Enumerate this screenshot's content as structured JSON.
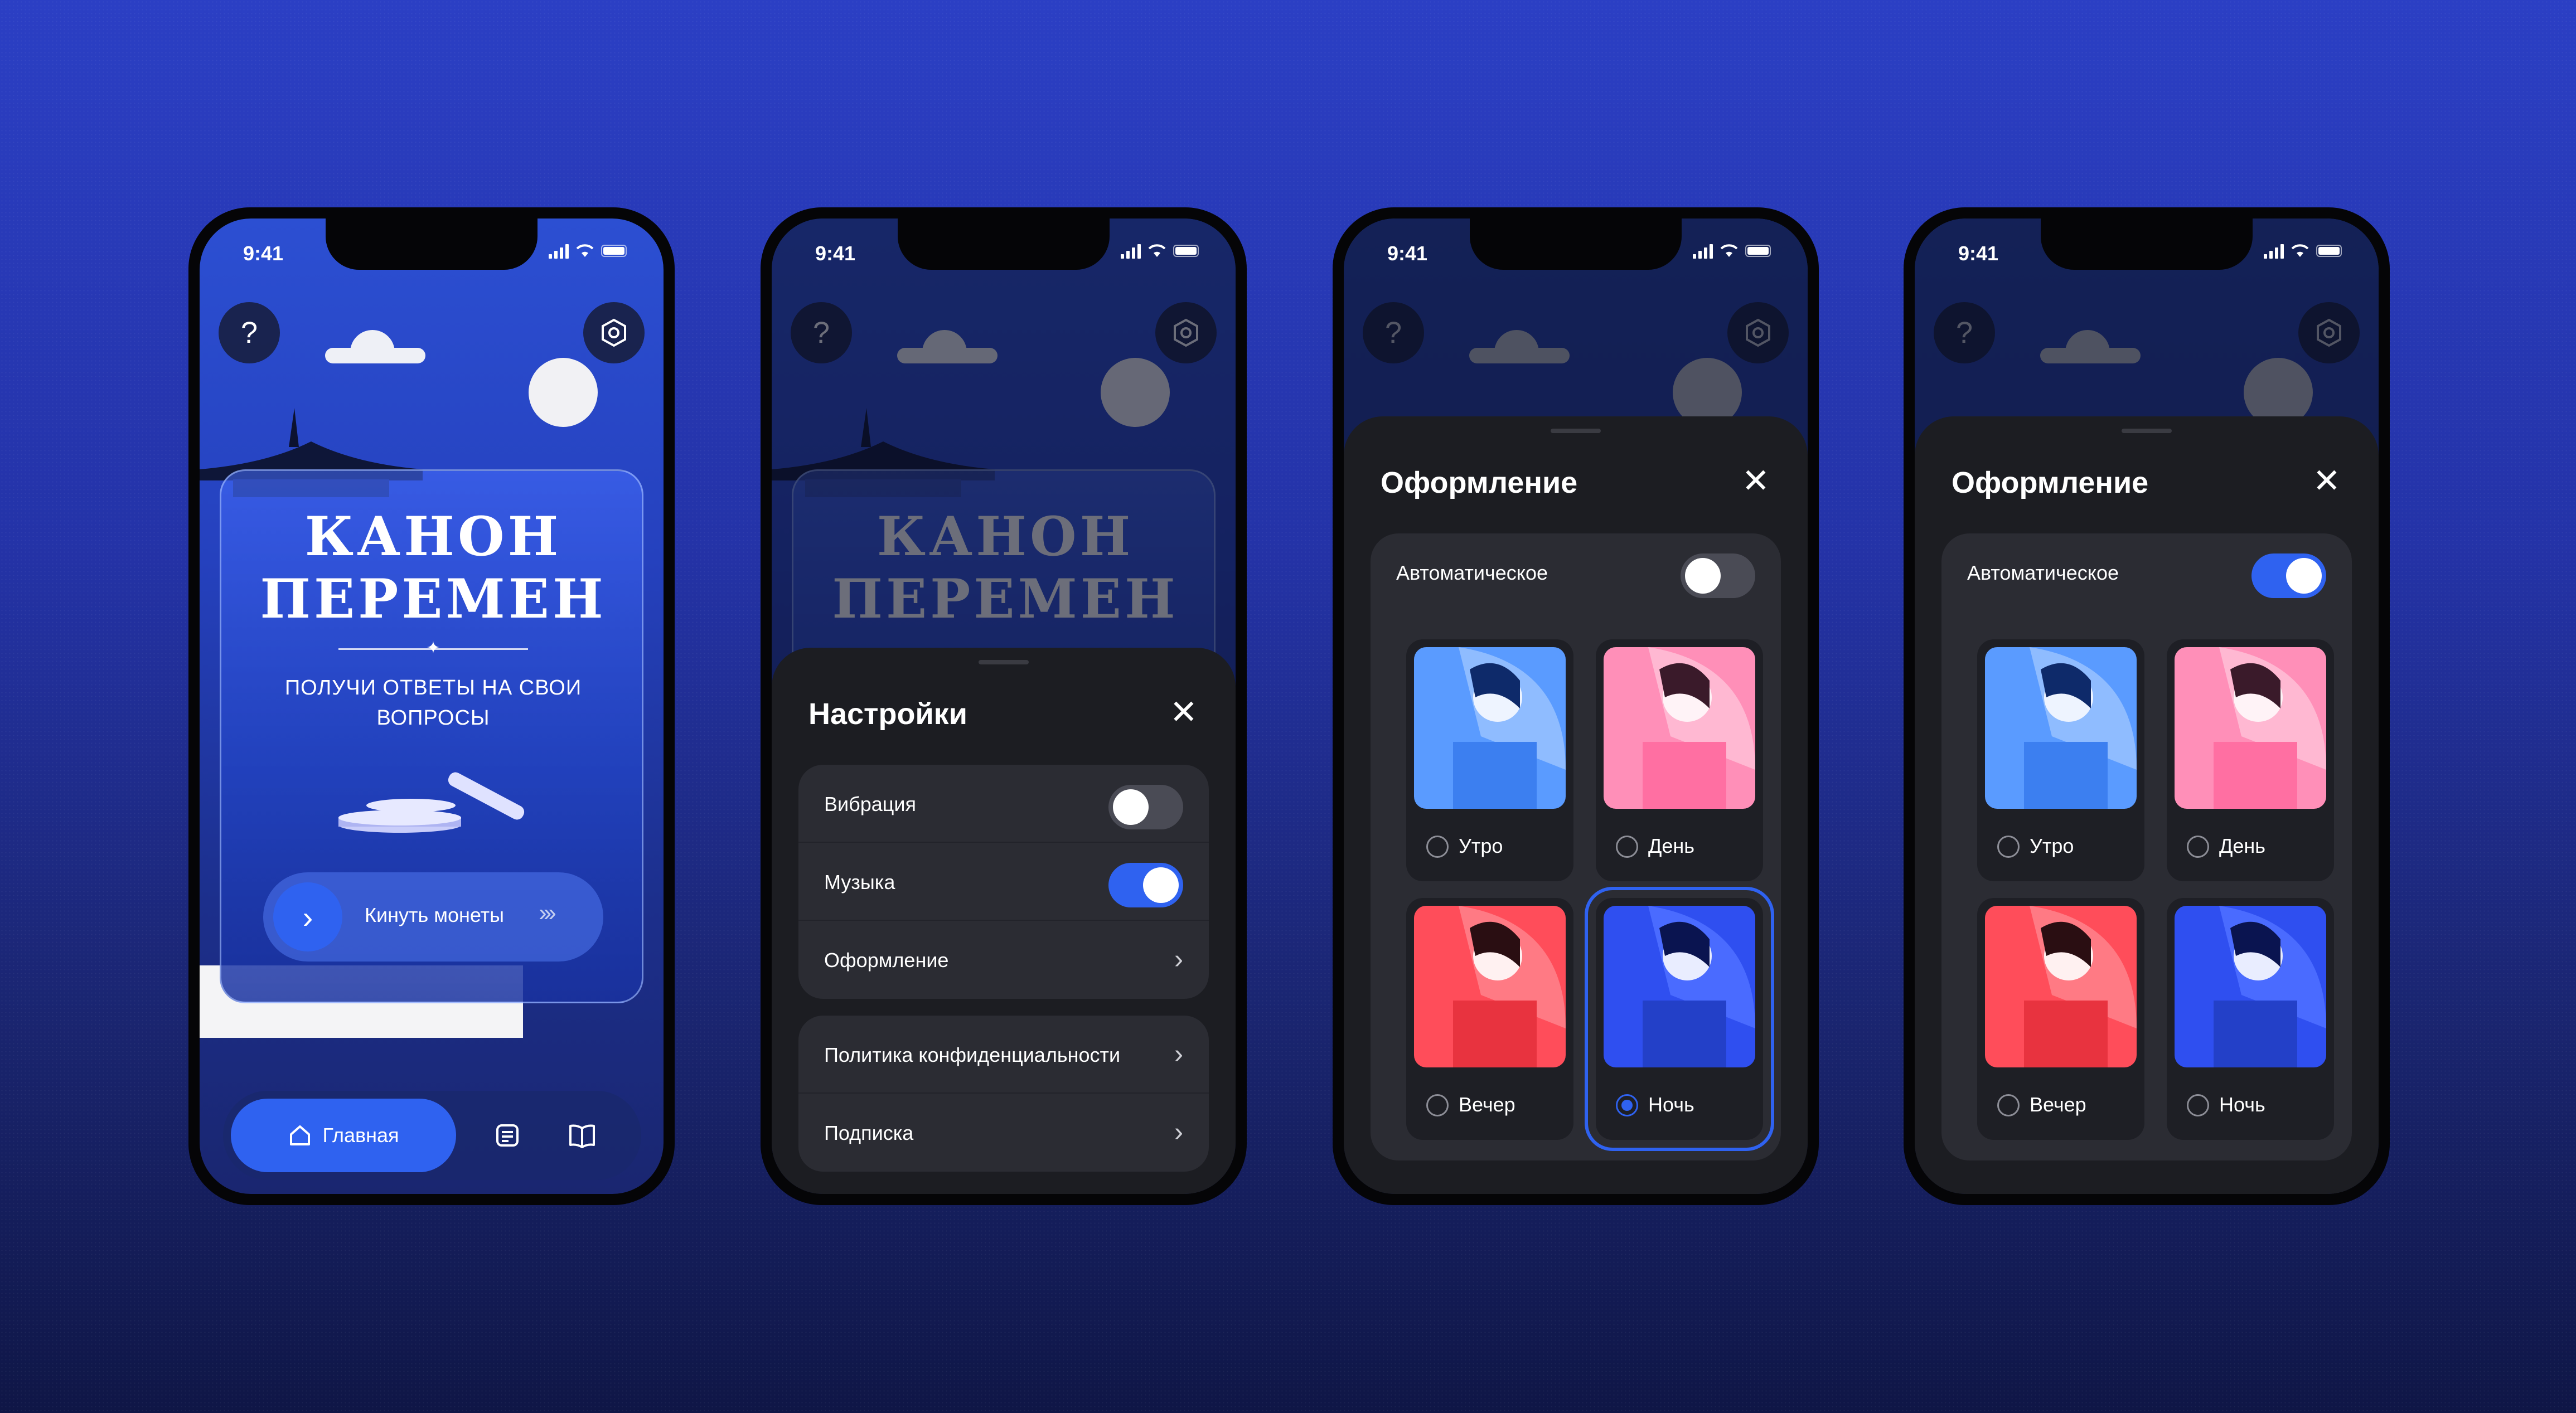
{
  "status": {
    "time": "9:41"
  },
  "home": {
    "title_line1": "КАНОН",
    "title_line2": "ПЕРЕМЕН",
    "subtitle": "ПОЛУЧИ ОТВЕТЫ НА СВОИ ВОПРОСЫ",
    "help_icon": "?",
    "throw_button": "Кинуть монеты",
    "tabs": {
      "home_label": "Главная"
    }
  },
  "settings": {
    "title": "Настройки",
    "rows": [
      {
        "label": "Вибрация",
        "type": "toggle",
        "on": false
      },
      {
        "label": "Музыка",
        "type": "toggle",
        "on": true
      },
      {
        "label": "Оформление",
        "type": "link"
      }
    ],
    "rows2": [
      {
        "label": "Политика конфиденциальности",
        "type": "link"
      },
      {
        "label": "Подписка",
        "type": "link"
      }
    ]
  },
  "theme": {
    "title": "Оформление",
    "auto_label": "Автоматическое",
    "options": [
      "Утро",
      "День",
      "Вечер",
      "Ночь"
    ],
    "screen3": {
      "auto": false,
      "selected": "Ночь"
    },
    "screen4": {
      "auto": true,
      "selected": ""
    }
  },
  "colors": {
    "accent": "#2f62f0",
    "sheet": "#1c1d22",
    "group": "#2b2c33",
    "morning": "#5a9bff",
    "day": "#ff8fb8",
    "evening": "#ff4d5a",
    "night": "#2f4ff0"
  }
}
